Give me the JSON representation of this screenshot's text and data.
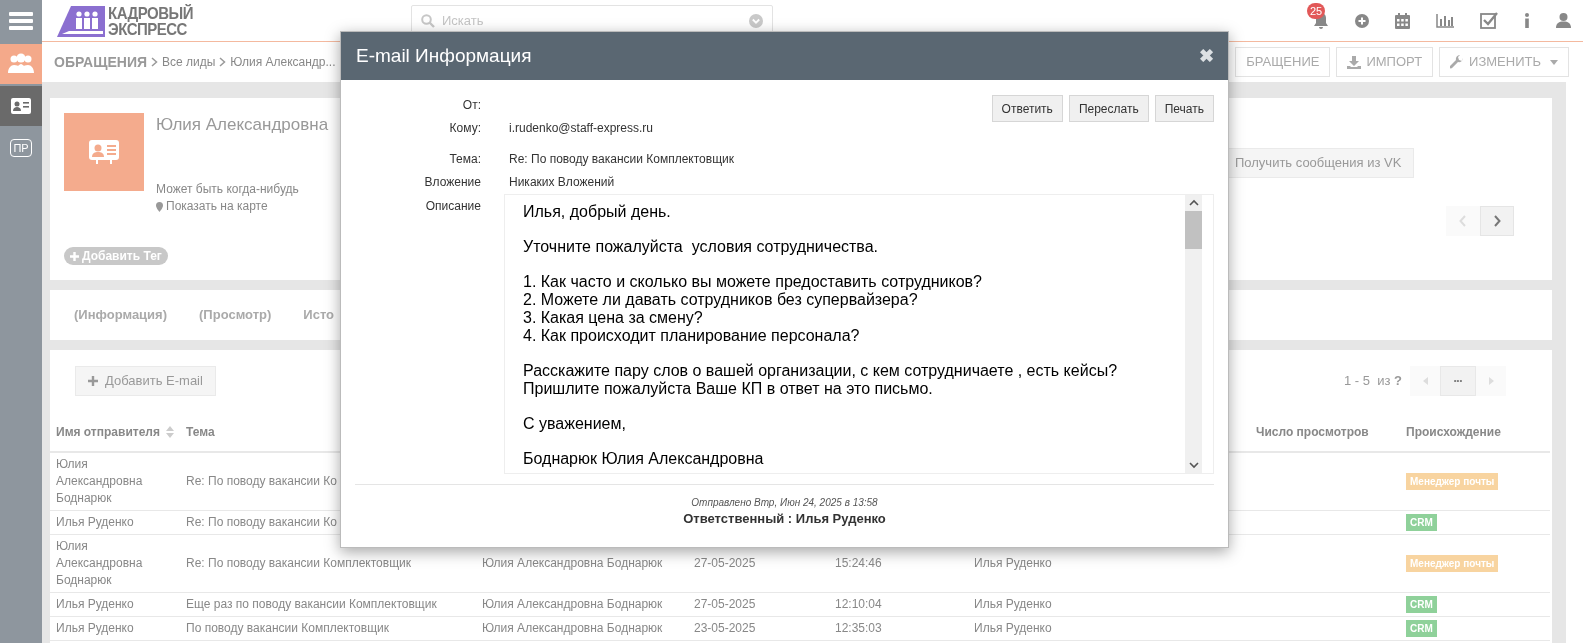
{
  "sidebar": {
    "items": [
      {
        "kind": "menu"
      },
      {
        "kind": "people"
      },
      {
        "kind": "card"
      },
      {
        "kind": "text",
        "label": "ПР"
      }
    ]
  },
  "topbar": {
    "logo_lines": [
      "КАДРОВЫЙ",
      "ЭКСПРЕСС"
    ],
    "search": {
      "placeholder": "Искать"
    },
    "icons": [
      {
        "kind": "bell",
        "badge": "25"
      },
      {
        "kind": "plus"
      },
      {
        "kind": "calendar"
      },
      {
        "kind": "chart"
      },
      {
        "kind": "check"
      },
      {
        "kind": "info"
      },
      {
        "kind": "user"
      }
    ]
  },
  "breadcrumb": {
    "title": "ОБРАЩЕНИЯ",
    "items": [
      "Все лиды",
      "Юлия Александр..."
    ],
    "actions": [
      {
        "kind": "plain",
        "label": "БРАЩЕНИЕ"
      },
      {
        "kind": "import",
        "label": "ИМПОРТ"
      },
      {
        "kind": "edit",
        "label": "ИЗМЕНИТЬ"
      }
    ]
  },
  "contact": {
    "name": "Юлия Александровна",
    "status": "Может быть когда-нибудь",
    "map_link": "Показать на карте",
    "add_tag": "Добавить Тег",
    "vk_button": "Получить сообщения из VK"
  },
  "tabs": [
    {
      "label": "(Информация)"
    },
    {
      "label": "(Просмотр)"
    },
    {
      "label": "Исто"
    }
  ],
  "emails": {
    "add_button": "Добавить E-mail",
    "pagination": "1 - 5  из **?**",
    "more": "•••",
    "headers": {
      "column_1": "Имя отправителя",
      "column_2": "Тема",
      "column_7": "Число просмотров",
      "column_8": "Происхождение"
    },
    "rows": [
      {
        "sender": "Юлия Александровна Боднарюк",
        "subject": "Re: По поводу вакансии Ко",
        "origin": {
          "label": "Менеджер почты",
          "color": "#f8d4a0"
        }
      },
      {
        "sender": "Илья Руденко",
        "subject": "Re: По поводу вакансии Ко",
        "origin": {
          "label": "CRM",
          "color": "#8fd19a"
        }
      },
      {
        "sender": "Юлия Александровна Боднарюк",
        "subject": "Re: По поводу вакансии Комплектовщик",
        "column_3": "Юлия Александровна Боднарюк",
        "date": "27-05-2025",
        "time": "15:24:46",
        "column_6": "Илья Руденко",
        "origin": {
          "label": "Менеджер почты",
          "color": "#f8d4a0"
        }
      },
      {
        "sender": "Илья Руденко",
        "subject": "Еще раз по поводу вакансии Комплектовщик",
        "column_3": "Юлия Александровна Боднарюк",
        "date": "27-05-2025",
        "time": "12:10:04",
        "column_6": "Илья Руденко",
        "origin": {
          "label": "CRM",
          "color": "#8fd19a"
        }
      },
      {
        "sender": "Илья Руденко",
        "subject": "По поводу вакансии Комплектовщик",
        "column_3": "Юлия Александровна Боднарюк",
        "date": "23-05-2025",
        "time": "12:35:03",
        "column_6": "Илья Руденко",
        "origin": {
          "label": "CRM",
          "color": "#8fd19a"
        }
      }
    ]
  },
  "modal": {
    "title": "E-mail Информация",
    "close": "✖",
    "header_fields": [
      {
        "label": "От:"
      },
      {
        "label": "Кому:",
        "value": "i.rudenko@staff-express.ru"
      }
    ],
    "buttons": [
      "Ответить",
      "Переслать",
      "Печать"
    ],
    "detail_fields": [
      {
        "label": "Тема:",
        "value": "Re: По поводу вакансии Комплектовщик"
      },
      {
        "label": "Вложение",
        "value": "Никаких Вложений"
      }
    ],
    "description_label": "Описание",
    "body": [
      "Илья, добрый день.",
      "Уточните пожалуйста  условия сотрудничества.",
      "1. Как часто и сколько вы можете предоставить сотрудников?\n2. Можете ли давать сотрудников без супервайзера?\n3. Какая цена за смену?\n4. Как происходит планирование персонала?",
      "Расскажите пару слов о вашей организации, с кем сотрудничаете , есть кейсы?\nПришлите пожалуйста Ваше КП в ответ на это письмо.",
      "С уважением,",
      "Боднарюк Юлия Александровна"
    ],
    "sent": "Отправлено Втр, Июн 24, 2025 в 13:58",
    "responsible": "Ответственный : Илья Руденко"
  }
}
